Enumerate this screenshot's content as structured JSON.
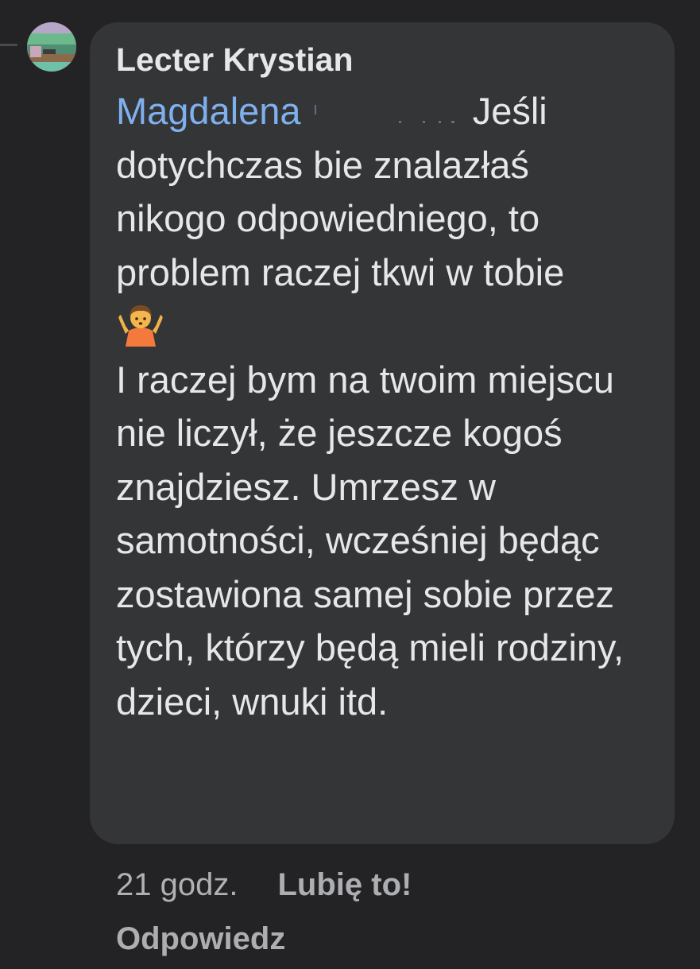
{
  "comment": {
    "author": "Lecter Krystian",
    "mention": "Magdalena",
    "paragraph_1_after_mention": " Jeśli dotychczas bie znalazłaś nikogo odpowiedniego, to problem raczej tkwi w tobie",
    "emoji": "person-shrugging-emoji",
    "paragraph_2": "I raczej bym na twoim miejscu nie liczył, że jeszcze kogoś znajdziesz. Umrzesz w samotności, wcześniej będąc zostawiona samej sobie przez tych, którzy będą mieli rodziny, dzieci, wnuki itd."
  },
  "actions": {
    "timestamp": "21 godz.",
    "like_label": "Lubię to!",
    "reply_label": "Odpowiedz"
  },
  "colors": {
    "background": "#232325",
    "bubble": "#343537",
    "text": "#e6e7e9",
    "mention": "#7fb0ee",
    "secondary": "#adaeb1"
  }
}
